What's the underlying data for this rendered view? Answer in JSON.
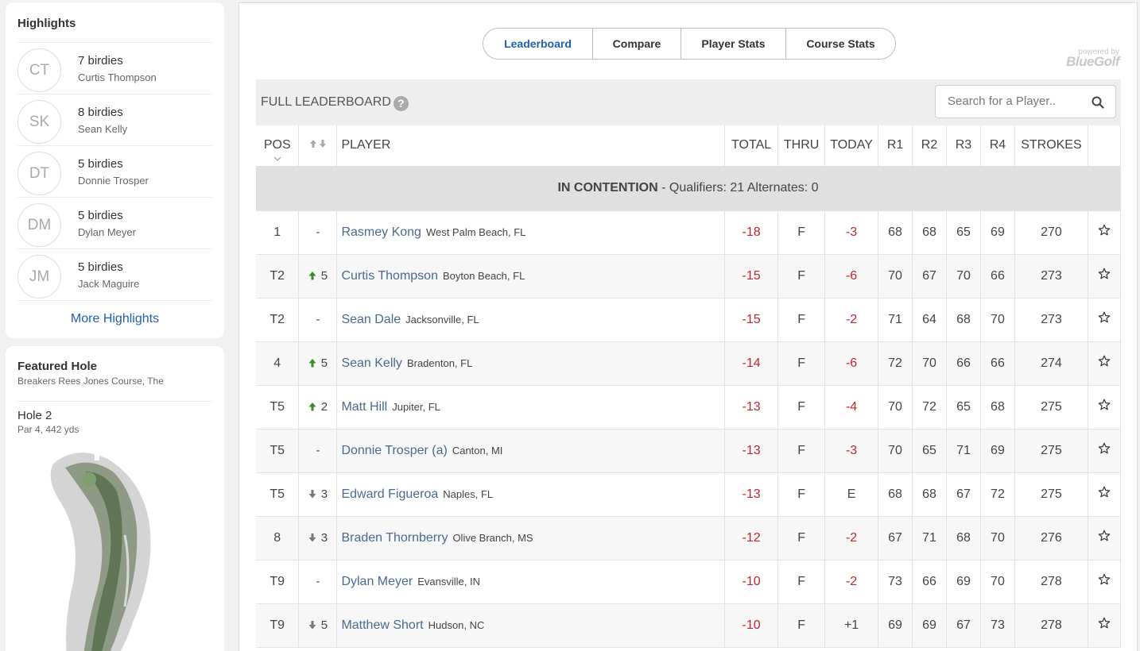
{
  "highlights": {
    "title": "Highlights",
    "items": [
      {
        "initials": "CT",
        "stat": "7 birdies",
        "name": "Curtis Thompson"
      },
      {
        "initials": "SK",
        "stat": "8 birdies",
        "name": "Sean Kelly"
      },
      {
        "initials": "DT",
        "stat": "5 birdies",
        "name": "Donnie Trosper"
      },
      {
        "initials": "DM",
        "stat": "5 birdies",
        "name": "Dylan Meyer"
      },
      {
        "initials": "JM",
        "stat": "5 birdies",
        "name": "Jack Maguire"
      }
    ],
    "more_label": "More Highlights"
  },
  "featured": {
    "title": "Featured Hole",
    "course": "Breakers Rees Jones Course, The",
    "hole": "Hole 2",
    "par_yds": "Par 4, 442 yds"
  },
  "tabs": [
    "Leaderboard",
    "Compare",
    "Player Stats",
    "Course Stats"
  ],
  "powered": {
    "line1": "powered by",
    "line2": "BlueGolf"
  },
  "leaderboard": {
    "title": "FULL LEADERBOARD",
    "help": "?",
    "search_placeholder": "Search for a Player..",
    "headers": {
      "pos": "POS",
      "player": "PLAYER",
      "total": "TOTAL",
      "thru": "THRU",
      "today": "TODAY",
      "r1": "R1",
      "r2": "R2",
      "r3": "R3",
      "r4": "R4",
      "strokes": "STROKES"
    },
    "section": {
      "label": "IN CONTENTION",
      "rest": " - Qualifiers: 21  Alternates: 0"
    },
    "rows": [
      {
        "pos": "1",
        "move_dir": "none",
        "move": "-",
        "name": "Rasmey Kong",
        "loc": "West Palm Beach, FL",
        "total": "-18",
        "thru": "F",
        "today": "-3",
        "r1": "68",
        "r2": "68",
        "r3": "65",
        "r4": "69",
        "strokes": "270"
      },
      {
        "pos": "T2",
        "move_dir": "up",
        "move": "5",
        "name": "Curtis Thompson",
        "loc": "Boyton Beach, FL",
        "total": "-15",
        "thru": "F",
        "today": "-6",
        "r1": "70",
        "r2": "67",
        "r3": "70",
        "r4": "66",
        "strokes": "273"
      },
      {
        "pos": "T2",
        "move_dir": "none",
        "move": "-",
        "name": "Sean Dale",
        "loc": "Jacksonville, FL",
        "total": "-15",
        "thru": "F",
        "today": "-2",
        "r1": "71",
        "r2": "64",
        "r3": "68",
        "r4": "70",
        "strokes": "273"
      },
      {
        "pos": "4",
        "move_dir": "up",
        "move": "5",
        "name": "Sean Kelly",
        "loc": "Bradenton, FL",
        "total": "-14",
        "thru": "F",
        "today": "-6",
        "r1": "72",
        "r2": "70",
        "r3": "66",
        "r4": "66",
        "strokes": "274"
      },
      {
        "pos": "T5",
        "move_dir": "up",
        "move": "2",
        "name": "Matt Hill",
        "loc": "Jupiter, FL",
        "total": "-13",
        "thru": "F",
        "today": "-4",
        "r1": "70",
        "r2": "72",
        "r3": "65",
        "r4": "68",
        "strokes": "275"
      },
      {
        "pos": "T5",
        "move_dir": "none",
        "move": "-",
        "name": "Donnie Trosper (a)",
        "loc": "Canton, MI",
        "total": "-13",
        "thru": "F",
        "today": "-3",
        "r1": "70",
        "r2": "65",
        "r3": "71",
        "r4": "69",
        "strokes": "275"
      },
      {
        "pos": "T5",
        "move_dir": "down",
        "move": "3",
        "name": "Edward Figueroa",
        "loc": "Naples, FL",
        "total": "-13",
        "thru": "F",
        "today": "E",
        "r1": "68",
        "r2": "68",
        "r3": "67",
        "r4": "72",
        "strokes": "275"
      },
      {
        "pos": "8",
        "move_dir": "down",
        "move": "3",
        "name": "Braden Thornberry",
        "loc": "Olive Branch, MS",
        "total": "-12",
        "thru": "F",
        "today": "-2",
        "r1": "67",
        "r2": "71",
        "r3": "68",
        "r4": "70",
        "strokes": "276"
      },
      {
        "pos": "T9",
        "move_dir": "none",
        "move": "-",
        "name": "Dylan Meyer",
        "loc": "Evansville, IN",
        "total": "-10",
        "thru": "F",
        "today": "-2",
        "r1": "73",
        "r2": "66",
        "r3": "69",
        "r4": "70",
        "strokes": "278"
      },
      {
        "pos": "T9",
        "move_dir": "down",
        "move": "5",
        "name": "Matthew Short",
        "loc": "Hudson, NC",
        "total": "-10",
        "thru": "F",
        "today": "+1",
        "r1": "69",
        "r2": "69",
        "r3": "67",
        "r4": "73",
        "strokes": "278"
      }
    ]
  },
  "colors": {
    "link": "#4a6a8f",
    "accent": "#1e5fb3",
    "under_par": "#c0262d",
    "arrow_up": "#3a8a2a",
    "arrow_down": "#777777"
  }
}
